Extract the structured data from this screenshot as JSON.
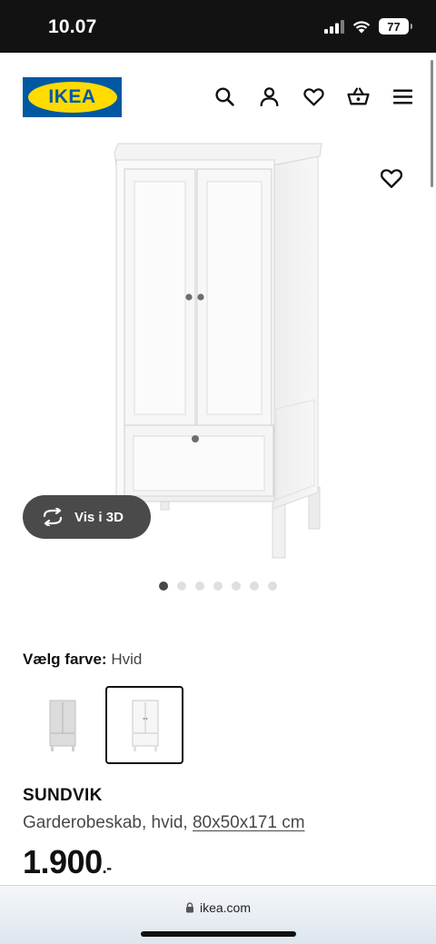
{
  "status_bar": {
    "time": "10.07",
    "battery": "77",
    "icons": [
      "signal-icon",
      "wifi-icon",
      "battery-icon"
    ]
  },
  "header": {
    "logo_text": "IKEA",
    "icons": [
      "search-icon",
      "user-icon",
      "heart-icon",
      "basket-icon",
      "menu-icon"
    ],
    "brand_colors": {
      "blue": "#0058a3",
      "yellow": "#ffdb00"
    }
  },
  "gallery": {
    "view_3d_label": "Vis i 3D",
    "dot_count": 7,
    "active_dot": 1
  },
  "color_select": {
    "label": "Vælg farve:",
    "value": "Hvid"
  },
  "product": {
    "name": "SUNDVIK",
    "description": "Garderobeskab, hvid,",
    "size": "80x50x171 cm",
    "price": "1.900",
    "price_suffix": ".-"
  },
  "browser": {
    "url": "ikea.com"
  }
}
